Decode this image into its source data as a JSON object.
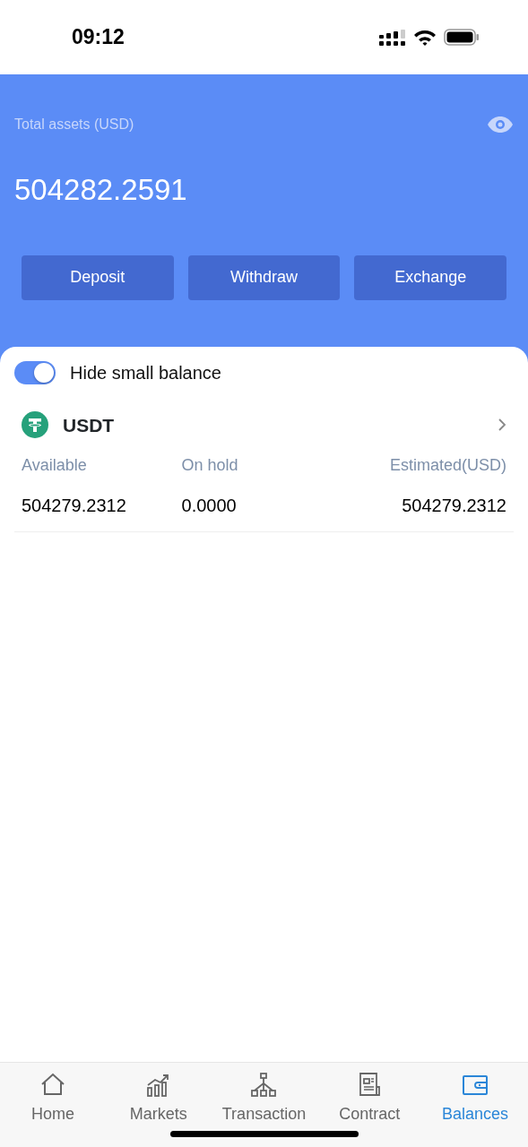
{
  "status_bar": {
    "time": "09:12"
  },
  "header": {
    "label": "Total assets (USD)",
    "total": "504282.2591",
    "balance_visible": true
  },
  "actions": [
    "Deposit",
    "Withdraw",
    "Exchange"
  ],
  "hide_small_balance": {
    "label": "Hide small balance",
    "on": true
  },
  "assets": [
    {
      "symbol": "USDT",
      "columns": [
        {
          "label": "Available",
          "value": "504279.2312"
        },
        {
          "label": "On hold",
          "value": "0.0000"
        },
        {
          "label": "Estimated(USD)",
          "value": "504279.2312"
        }
      ]
    }
  ],
  "tabs": [
    {
      "label": "Home",
      "selected": false
    },
    {
      "label": "Markets",
      "selected": false
    },
    {
      "label": "Transaction",
      "selected": false
    },
    {
      "label": "Contract",
      "selected": false
    },
    {
      "label": "Balances",
      "selected": true
    }
  ]
}
